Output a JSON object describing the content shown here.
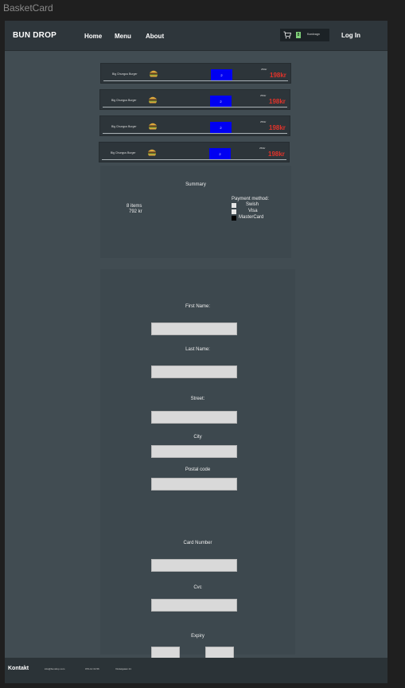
{
  "frame_title": "BasketCard",
  "nav": {
    "brand": "BUN DROP",
    "home": "Home",
    "menu": "Menu",
    "about": "About",
    "login": "Log In",
    "cart_count": "8",
    "cart_label": "Kundvagn"
  },
  "items": [
    {
      "name": "Big Chungus Burger",
      "qty": "2",
      "small": "250kr",
      "price": "198kr"
    },
    {
      "name": "Big Chungus Burger",
      "qty": "2",
      "small": "250kr",
      "price": "198kr"
    },
    {
      "name": "Big Chungus Burger",
      "qty": "2",
      "small": "250kr",
      "price": "198kr"
    },
    {
      "name": "Big Chungus Burger",
      "qty": "2",
      "small": "250kr",
      "price": "198kr"
    }
  ],
  "summary": {
    "title": "Summary",
    "count": "8 items",
    "total": "792 kr",
    "payment_title": "Payment method:",
    "options": [
      "Swish",
      "Visa",
      "MasterCard"
    ],
    "checked_index": 2
  },
  "form": {
    "first_name": "First Name:",
    "last_name": "Last Name:",
    "street": "Street:",
    "city": "City",
    "postal_code": "Postal code",
    "card_number": "Card Number",
    "cvc": "Cvc",
    "expiry": "Expiry"
  },
  "footer": {
    "title": "Kontakt",
    "email": "info@bundrop.com",
    "phone": "070-12 34 56",
    "address": "Vindelgatan 21"
  },
  "colors": {
    "qty_bg": "#0000f2",
    "price": "#e1332a",
    "cart_badge": "#7fcf7a"
  }
}
